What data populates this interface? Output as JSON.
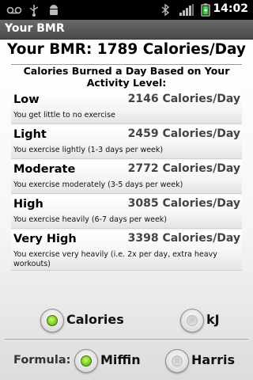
{
  "status_bar": {
    "time": "14:02",
    "icons": [
      "voicemail-icon",
      "usb-icon",
      "android-debug-icon",
      "bluetooth-icon",
      "signal-icon",
      "battery-charging-icon"
    ]
  },
  "title_bar": {
    "title": "Your BMR"
  },
  "main": {
    "bmr_heading": "Your BMR: 1789 Calories/Day",
    "subheading": "Calories Burned a Day Based on Your Activity Level:",
    "levels": [
      {
        "name": "Low",
        "calories": "2146 Calories/Day",
        "description": "You get little to no exercise"
      },
      {
        "name": "Light",
        "calories": "2459 Calories/Day",
        "description": "You exercise lightly (1-3 days per week)"
      },
      {
        "name": "Moderate",
        "calories": "2772 Calories/Day",
        "description": "You exercise moderately (3-5 days per week)"
      },
      {
        "name": "High",
        "calories": "3085 Calories/Day",
        "description": "You exercise heavily (6-7 days per week)"
      },
      {
        "name": "Very High",
        "calories": "3398 Calories/Day",
        "description": "You exercise very heavily (i.e. 2x per day, extra heavy workouts)"
      }
    ]
  },
  "units": {
    "options": [
      {
        "label": "Calories",
        "selected": true
      },
      {
        "label": "kJ",
        "selected": false
      }
    ]
  },
  "formula": {
    "label": "Formula:",
    "options": [
      {
        "label": "Miffin",
        "selected": true
      },
      {
        "label": "Harris",
        "selected": false
      }
    ]
  },
  "colors": {
    "radio_selected": "#4aa000",
    "title_bar": "#555555",
    "status_bar": "#000000"
  }
}
